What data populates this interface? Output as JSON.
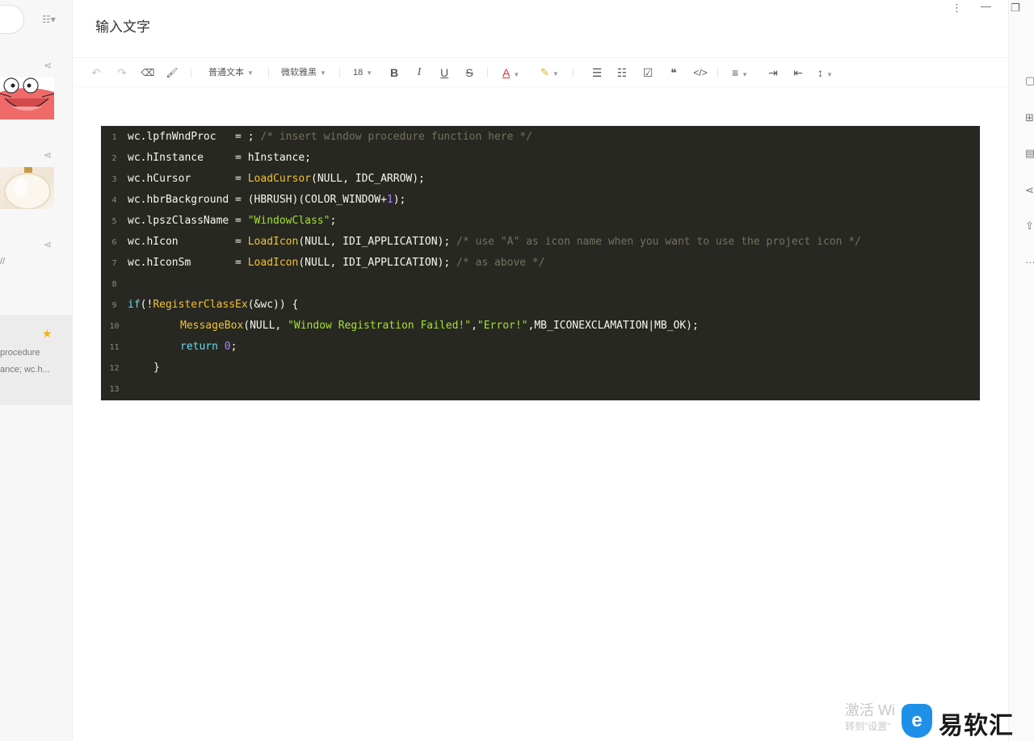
{
  "title": "输入文字",
  "left_list": {
    "snippet_fragment": "//",
    "active_item": {
      "line1": "procedure",
      "line2": "ance; wc.h..."
    }
  },
  "toolbar": {
    "undo": "↶",
    "redo": "↷",
    "eraser": "⌫",
    "format_painter": "🖌",
    "paragraph_style": "普通文本",
    "font_family": "微软雅黑",
    "font_size": "18",
    "bold": "B",
    "italic": "I",
    "underline": "U",
    "strike": "S",
    "font_color": "A",
    "highlight": "✎",
    "ul": "☰",
    "ol": "☷",
    "checkbox": "☑",
    "quote": "❝",
    "code": "</>",
    "align": "≡",
    "indent": "⇥",
    "outdent": "⇤",
    "line_height": "↕"
  },
  "code_lines": [
    {
      "n": "1"
    },
    {
      "n": "2"
    },
    {
      "n": "3"
    },
    {
      "n": "4"
    },
    {
      "n": "5"
    },
    {
      "n": "6"
    },
    {
      "n": "7"
    },
    {
      "n": "8"
    },
    {
      "n": "9"
    },
    {
      "n": "10"
    },
    {
      "n": "11"
    },
    {
      "n": "12"
    },
    {
      "n": "13"
    }
  ],
  "code": {
    "l1_a": "wc.lpfnWndProc   = ; ",
    "l1_c": "/* insert window procedure function here */",
    "l2_a": "wc.hInstance     = hInstance;",
    "l3_a": "wc.hCursor       = ",
    "l3_f": "LoadCursor",
    "l3_b": "(NULL, IDC_ARROW);",
    "l4_a": "wc.hbrBackground = (HBRUSH)(COLOR_WINDOW+",
    "l4_n": "1",
    "l4_b": ");",
    "l5_a": "wc.lpszClassName = ",
    "l5_s": "\"WindowClass\"",
    "l5_b": ";",
    "l6_a": "wc.hIcon         = ",
    "l6_f": "LoadIcon",
    "l6_b": "(NULL, IDI_APPLICATION); ",
    "l6_c": "/* use \"A\" as icon name when you want to use the project icon */",
    "l7_a": "wc.hIconSm       = ",
    "l7_f": "LoadIcon",
    "l7_b": "(NULL, IDI_APPLICATION); ",
    "l7_c": "/* as above */",
    "l9_k": "if",
    "l9_a": "(!",
    "l9_f": "RegisterClassEx",
    "l9_b": "(&wc)) {",
    "l10_f": "MessageBox",
    "l10_a": "(NULL, ",
    "l10_s1": "\"Window Registration Failed!\"",
    "l10_b": ",",
    "l10_s2": "\"Error!\"",
    "l10_c": ",MB_ICONEXCLAMATION|MB_OK);",
    "l11_k": "return",
    "l11_n": "0",
    "l11_b": ";",
    "l12_a": "}"
  },
  "watermark": {
    "line1": "激活 Wi",
    "line2": "转到\"设置\"",
    "brand": "易软汇",
    "badge": "e"
  },
  "icons": {
    "share": "share-icon",
    "star": "star-icon",
    "more": "more-vertical-icon"
  }
}
